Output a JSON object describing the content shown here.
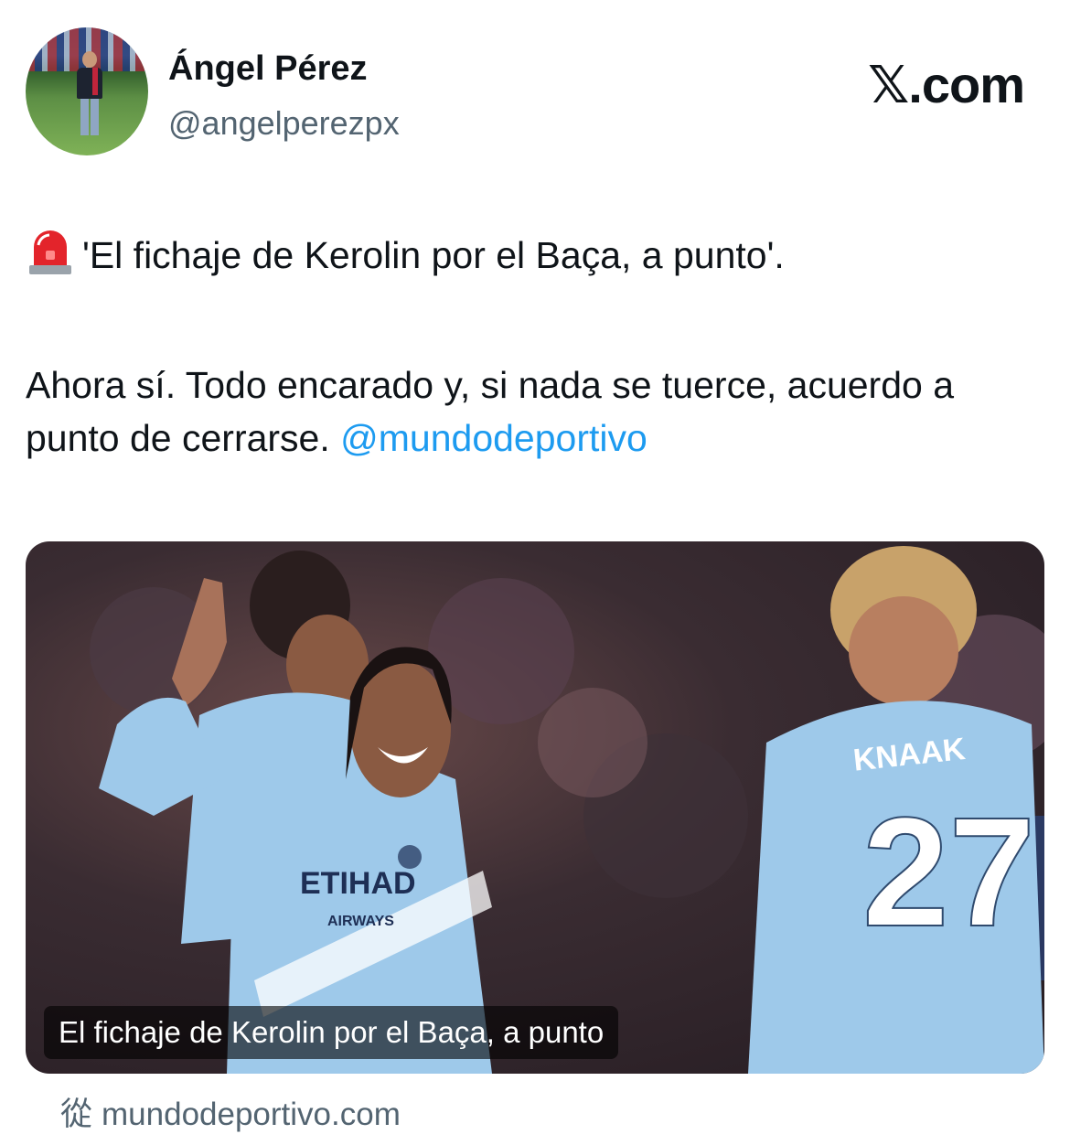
{
  "author": {
    "display_name": "Ángel Pérez",
    "handle": "@angelperezpx"
  },
  "brand": {
    "logo_text": "𝕏.com"
  },
  "tweet": {
    "siren_icon": "police-siren-icon",
    "line1": "'El fichaje de Kerolin por el Baça, a punto'.",
    "line2_text": "Ahora sí. Todo encarado y, si nada se tuerce, acuerdo a punto de cerrarse. ",
    "mention": "@mundodeportivo"
  },
  "media": {
    "caption": "El fichaje de Kerolin por el Baça, a punto",
    "shirt_sponsor": "ETIHAD",
    "shirt_sponsor_sub": "AIRWAYS",
    "player_name": "KNAAK",
    "player_number": "27"
  },
  "link_card": {
    "source_glyph": "從",
    "source_domain": "mundodeportivo.com"
  },
  "colors": {
    "text": "#0f1419",
    "secondary": "#536471",
    "link": "#1d9bf0",
    "shirt": "#9ec9ea"
  }
}
